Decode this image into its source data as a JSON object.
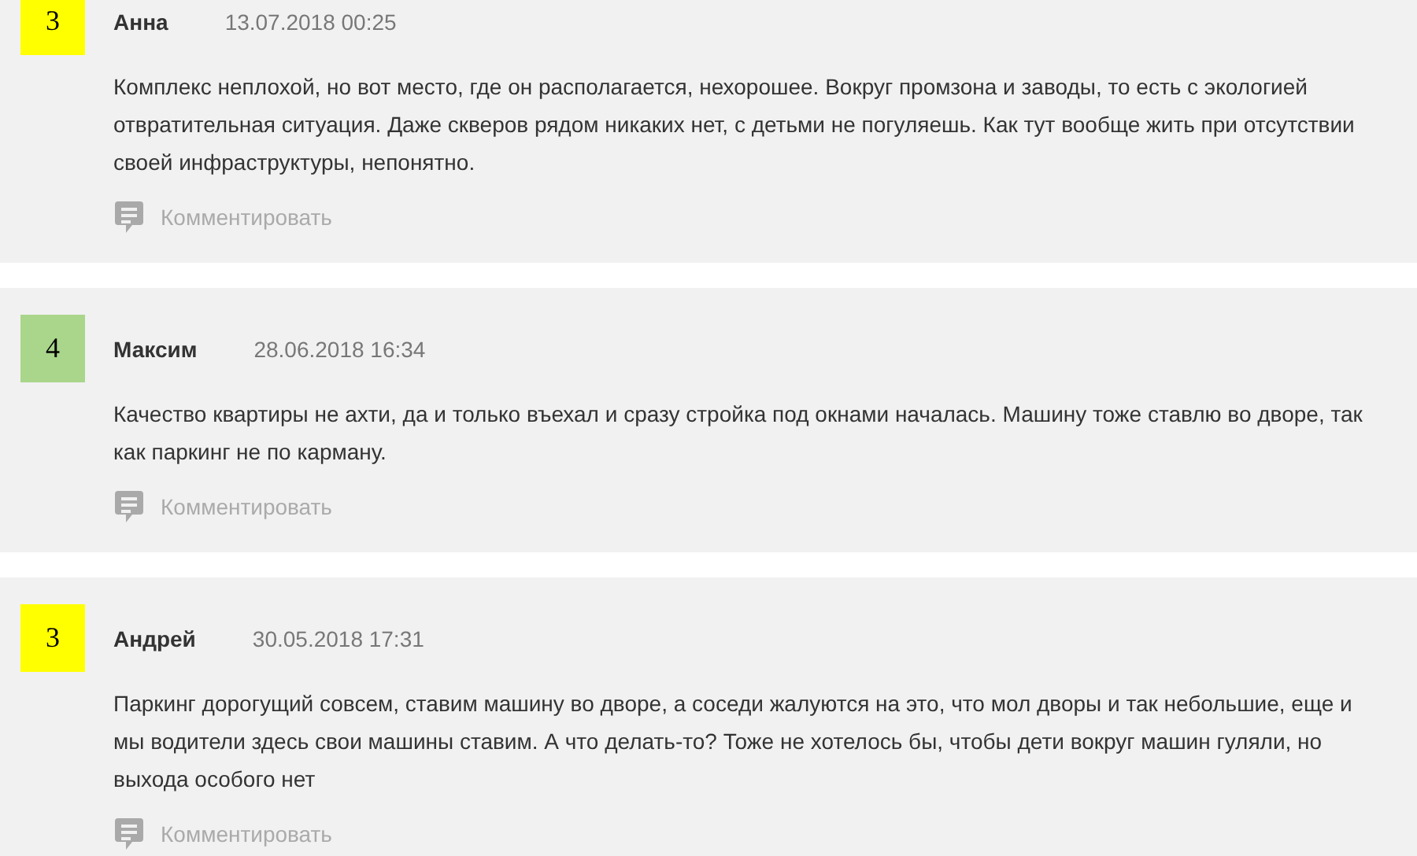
{
  "reviews": [
    {
      "rating": "3",
      "color": "#ffff00",
      "author": "Анна",
      "date": "13.07.2018 00:25",
      "text": "Комплекс неплохой, но вот место, где он располагается, нехорошее. Вокруг промзона и заводы, то есть с экологией отвратительная ситуация. Даже скверов рядом никаких нет, с детьми не погуляешь. Как тут вообще жить при отсутствии своей инфраструктуры, непонятно.",
      "comment_label": "Комментировать"
    },
    {
      "rating": "4",
      "color": "#a9d68b",
      "author": "Максим",
      "date": "28.06.2018 16:34",
      "text": "Качество квартиры не ахти, да и только въехал и сразу стройка под окнами началась. Машину тоже ставлю во дворе, так как паркинг не по карману.",
      "comment_label": "Комментировать"
    },
    {
      "rating": "3",
      "color": "#ffff00",
      "author": "Андрей",
      "date": "30.05.2018 17:31",
      "text": "Паркинг дорогущий совсем, ставим машину во дворе, а соседи жалуются на это, что мол дворы и так небольшие, еще и мы водители здесь свои машины ставим. А что делать-то? Тоже не хотелось бы, чтобы дети вокруг машин гуляли, но выхода особого нет",
      "comment_label": "Комментировать"
    }
  ]
}
